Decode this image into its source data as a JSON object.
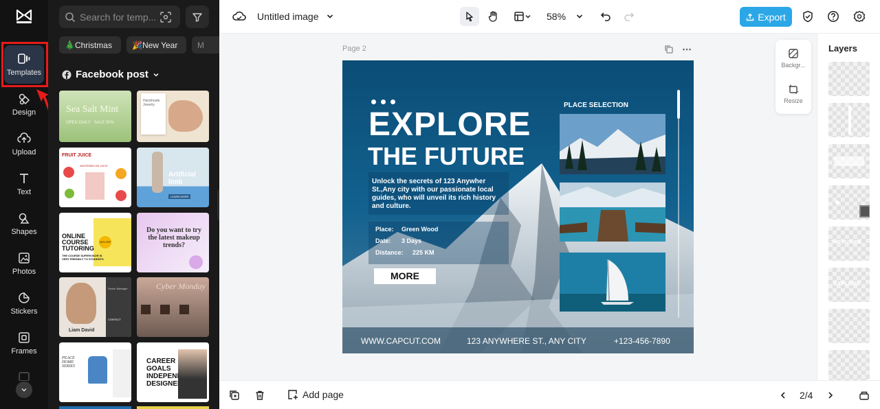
{
  "rail": {
    "items": [
      {
        "label": "Templates",
        "icon": "templates-icon"
      },
      {
        "label": "Design",
        "icon": "design-icon"
      },
      {
        "label": "Upload",
        "icon": "upload-icon"
      },
      {
        "label": "Text",
        "icon": "text-icon"
      },
      {
        "label": "Shapes",
        "icon": "shapes-icon"
      },
      {
        "label": "Photos",
        "icon": "photos-icon"
      },
      {
        "label": "Stickers",
        "icon": "stickers-icon"
      },
      {
        "label": "Frames",
        "icon": "frames-icon"
      }
    ]
  },
  "panel": {
    "search_placeholder": "Search for temp...",
    "chips": [
      "🎄Christmas",
      "🎉New Year",
      "M"
    ],
    "section_title": "Facebook post",
    "thumbs": [
      {
        "lines": [
          "Sea Salt Mint",
          "OPEN DAILY · SALE 30%"
        ]
      },
      {
        "lines": [
          "Handmade Jewelry"
        ]
      },
      {
        "lines": [
          "FRUIT JUICE",
          "WATERMELON JUICE"
        ]
      },
      {
        "lines": [
          "Artificial limb",
          "LEARN MORE"
        ]
      },
      {
        "lines": [
          "ONLINE COURSE TUTORING",
          "THE COURSE SUPERVISOR IS VERY FRIENDLY TO STUDENTS",
          "15% OFF"
        ]
      },
      {
        "lines": [
          "Do you want to try the latest makeup trends?"
        ]
      },
      {
        "lines": [
          "Liam David",
          "Senior Manager",
          "CONTACT"
        ]
      },
      {
        "lines": [
          "Cyber Monday"
        ]
      },
      {
        "lines": [
          "PEACE HOME SERIES"
        ]
      },
      {
        "lines": [
          "CAREER GOALS INDEPENDENT DESIGNER"
        ]
      }
    ]
  },
  "topbar": {
    "title": "Untitled image",
    "zoom": "58%",
    "export_label": "Export"
  },
  "canvas": {
    "page_label": "Page 2",
    "design": {
      "headline1": "EXPLORE",
      "headline2": "THE FUTURE",
      "body": "Unlock the secrets of 123 Anywher St.,Any city with our passionate local guides, who will unveil its rich history and culture.",
      "place_label": "Place:",
      "place_value": "Green Wood",
      "date_label": "Date:",
      "date_value": "3 Days",
      "distance_label": "Distance:",
      "distance_value": "225 KM",
      "more_button": "MORE",
      "place_selection": "PLACE SELECTION",
      "footer_web": "WWW.CAPCUT.COM",
      "footer_address": "123 ANYWHERE ST., ANY CITY",
      "footer_phone": "+123-456-7890"
    }
  },
  "side_tools": {
    "background_label": "Backgr...",
    "resize_label": "Resize"
  },
  "layers": {
    "title": "Layers",
    "items": [
      "",
      "",
      "",
      "",
      "THE FUTURE",
      "EXPLORE",
      "",
      ""
    ]
  },
  "bottombar": {
    "add_page": "Add page",
    "pager": "2/4"
  },
  "colors": {
    "accent": "#2ba7e8",
    "design_blue": "#0e5a88",
    "highlight": "#e81b1b"
  }
}
